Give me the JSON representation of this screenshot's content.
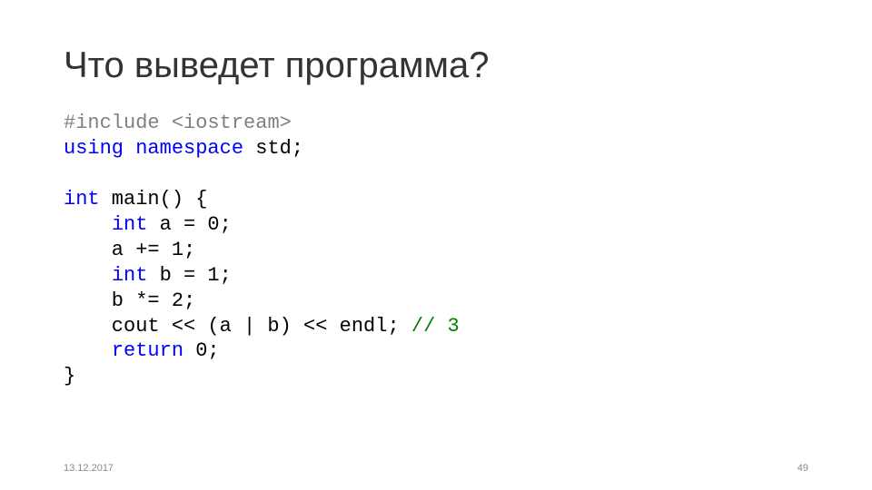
{
  "title": "Что выведет программа?",
  "code": {
    "l1_pp_include": "#include",
    "l1_space": " ",
    "l1_header": "<iostream>",
    "l2_kw_using": "using",
    "l2_mid": " ",
    "l2_kw_namespace": "namespace",
    "l2_end": " std;",
    "blank1": "",
    "l4_kw_int": "int",
    "l4_rest": " main() {",
    "l5_pad": "    ",
    "l5_kw_int": "int",
    "l5_rest": " a = 0;",
    "l6": "    a += 1;",
    "l7_pad": "    ",
    "l7_kw_int": "int",
    "l7_rest": " b = 1;",
    "l8": "    b *= 2;",
    "l9_pre": "    cout << (a | b) << endl; ",
    "l9_cmt": "// 3",
    "l10_pad": "    ",
    "l10_kw_return": "return",
    "l10_rest": " 0;",
    "l11": "}"
  },
  "footer": {
    "date": "13.12.2017",
    "page": "49"
  }
}
